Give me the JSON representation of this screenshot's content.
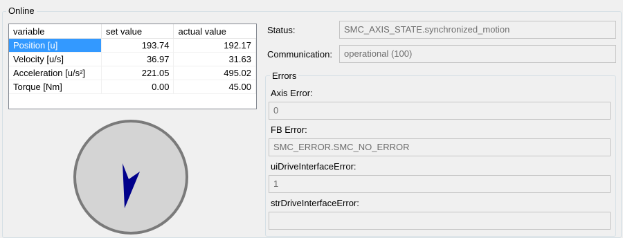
{
  "online": {
    "title": "Online",
    "table": {
      "headers": [
        "variable",
        "set value",
        "actual value"
      ],
      "rows": [
        {
          "variable": "Position [u]",
          "set": "193.74",
          "actual": "192.17"
        },
        {
          "variable": "Velocity [u/s]",
          "set": "36.97",
          "actual": "31.63"
        },
        {
          "variable": "Acceleration [u/s²]",
          "set": "221.05",
          "actual": "495.02"
        },
        {
          "variable": "Torque [Nm]",
          "set": "0.00",
          "actual": "45.00"
        }
      ],
      "selected_row": 0
    },
    "gauge": {
      "dial_color": "#d4d4d4",
      "ring_color": "#7a7a7a",
      "pointer_color": "#00008b"
    },
    "status": {
      "label": "Status:",
      "value": "SMC_AXIS_STATE.synchronized_motion"
    },
    "communication": {
      "label": "Communication:",
      "value": "operational (100)"
    },
    "errors": {
      "title": "Errors",
      "axis_error": {
        "label": "Axis Error:",
        "value": "0"
      },
      "fb_error": {
        "label": "FB Error:",
        "value": "SMC_ERROR.SMC_NO_ERROR"
      },
      "ui_drive_interface_error": {
        "label": "uiDriveInterfaceError:",
        "value": "1"
      },
      "str_drive_interface_error": {
        "label": "strDriveInterfaceError:",
        "value": ""
      }
    }
  }
}
